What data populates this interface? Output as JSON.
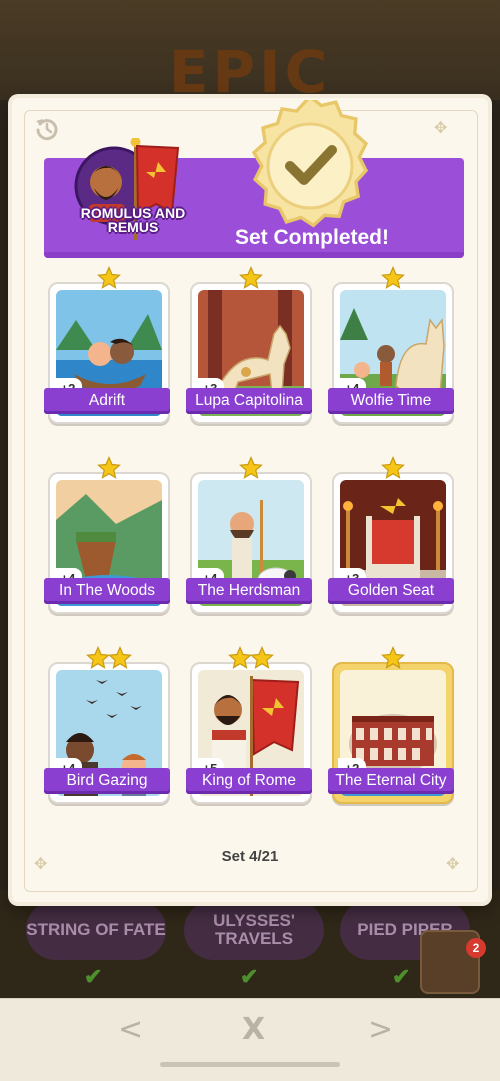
{
  "background": {
    "title": "EPIC",
    "other_sets": [
      "STRING OF FATE",
      "ULYSSES' TRAVELS",
      "PIED PIPER"
    ],
    "album_badge_count": "2"
  },
  "panel": {
    "set_name": "ROMULUS AND REMUS",
    "status": "Set Completed!",
    "set_counter": "Set 4/21",
    "colors": {
      "accent": "#9b4fd8",
      "label": "#8a3fd1",
      "star": "#f5c518"
    }
  },
  "cards": [
    {
      "name": "Adrift",
      "points": "+2",
      "stars": 1,
      "gold": false
    },
    {
      "name": "Lupa Capitolina",
      "points": "+3",
      "stars": 1,
      "gold": false
    },
    {
      "name": "Wolfie Time",
      "points": "+4",
      "stars": 1,
      "gold": false
    },
    {
      "name": "In The Woods",
      "points": "+4",
      "stars": 1,
      "gold": false
    },
    {
      "name": "The Herdsman",
      "points": "+4",
      "stars": 1,
      "gold": false
    },
    {
      "name": "Golden Seat",
      "points": "+3",
      "stars": 1,
      "gold": false
    },
    {
      "name": "Bird Gazing",
      "points": "+4",
      "stars": 2,
      "gold": false
    },
    {
      "name": "King of Rome",
      "points": "+5",
      "stars": 2,
      "gold": false
    },
    {
      "name": "The Eternal City",
      "points": "+2",
      "stars": 1,
      "gold": true
    }
  ],
  "nav": {
    "prev": "<",
    "close": "X",
    "next": ">"
  },
  "icons": [
    "history-icon",
    "checkmark-icon",
    "star-icon",
    "chevron-left-icon",
    "close-icon",
    "chevron-right-icon",
    "album-icon"
  ]
}
